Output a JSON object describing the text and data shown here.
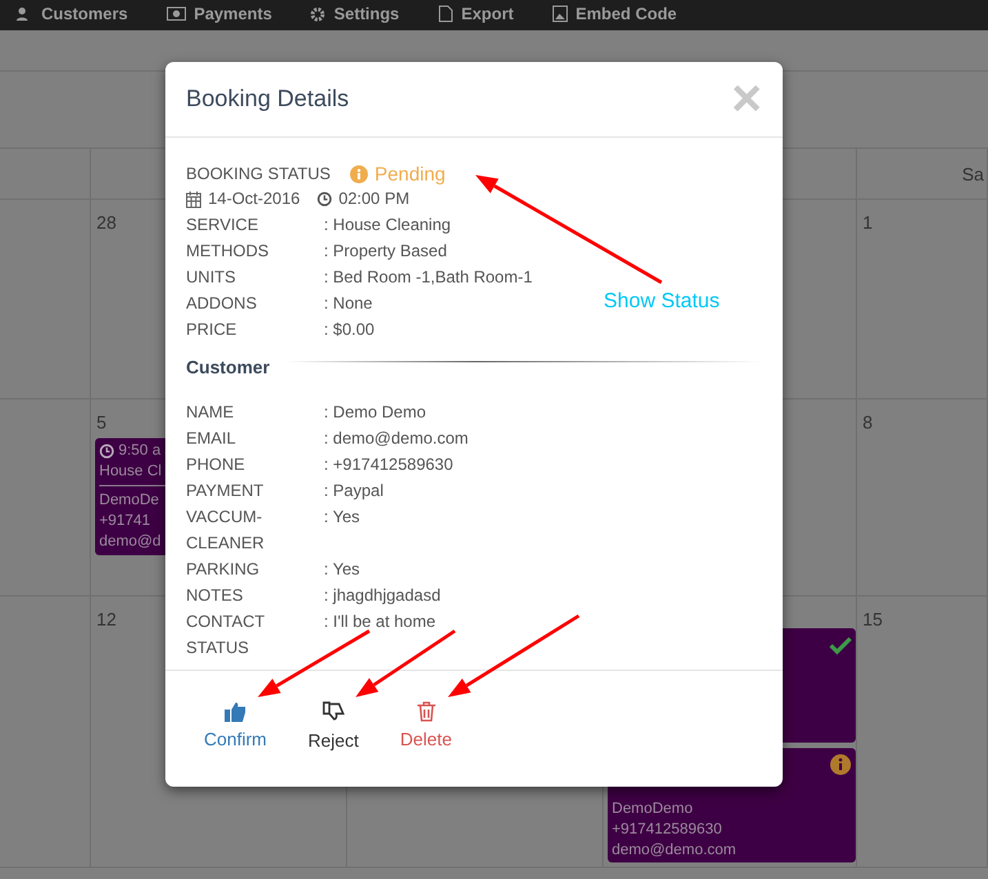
{
  "nav": {
    "items": [
      {
        "label": "Customers"
      },
      {
        "label": "Payments"
      },
      {
        "label": "Settings"
      },
      {
        "label": "Export"
      },
      {
        "label": "Embed Code"
      }
    ]
  },
  "calendar": {
    "header_cell": "Sa",
    "weeks": [
      {
        "cells": [
          {},
          {
            "day": "28"
          },
          {},
          {},
          {
            "day": "1"
          }
        ]
      },
      {
        "cells": [
          {},
          {
            "day": "5",
            "events": [
              {
                "kind": "full",
                "time": "9:50 a",
                "title": "House Cl",
                "lines": [
                  "DemoDe",
                  "+91741",
                  "demo@d"
                ]
              }
            ]
          },
          {},
          {},
          {
            "day": "8"
          }
        ]
      },
      {
        "cells": [
          {},
          {
            "day": "12"
          },
          {},
          {
            "events": [
              {
                "kind": "status",
                "confirmed": true
              },
              {
                "kind": "status",
                "confirmed": false,
                "lines": [
                  "DemoDemo",
                  "+917412589630",
                  "demo@demo.com"
                ]
              }
            ]
          },
          {
            "day": "15"
          }
        ]
      }
    ]
  },
  "modal": {
    "title": "Booking Details",
    "close": "×",
    "status": {
      "label": "BOOKING STATUS",
      "value": "Pending"
    },
    "date": "14-Oct-2016",
    "time": "02:00 PM",
    "details": [
      {
        "label": "SERVICE",
        "value": ": House Cleaning"
      },
      {
        "label": "METHODS",
        "value": ": Property Based"
      },
      {
        "label": "UNITS",
        "value": ": Bed Room -1,Bath Room-1"
      },
      {
        "label": "ADDONS",
        "value": ": None"
      },
      {
        "label": "PRICE",
        "value": ": $0.00"
      }
    ],
    "customer_heading": "Customer",
    "customer": [
      {
        "label": "NAME",
        "value": ": Demo Demo"
      },
      {
        "label": "EMAIL",
        "value": ": demo@demo.com"
      },
      {
        "label": "PHONE",
        "value": ": +917412589630"
      },
      {
        "label": "PAYMENT",
        "value": ": Paypal"
      },
      {
        "label": "VACCUM-CLEANER",
        "value": ": Yes"
      },
      {
        "label": "PARKING",
        "value": ": Yes"
      },
      {
        "label": "NOTES",
        "value": ": jhagdhjgadasd"
      },
      {
        "label": "CONTACT STATUS",
        "value": ": I'll be at home"
      }
    ],
    "actions": [
      {
        "kind": "confirm",
        "label": "Confirm"
      },
      {
        "kind": "reject",
        "label": "Reject"
      },
      {
        "kind": "delete",
        "label": "Delete"
      }
    ]
  },
  "annotation": {
    "text": "Show Status"
  }
}
